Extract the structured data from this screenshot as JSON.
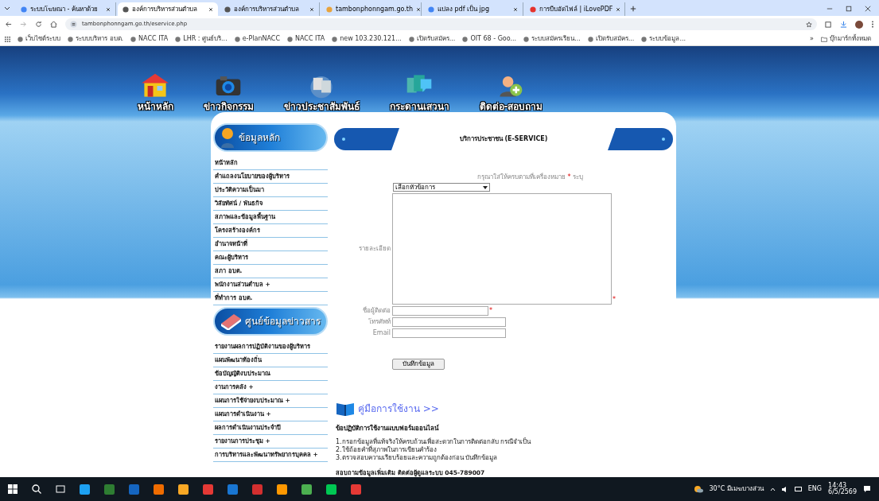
{
  "browser": {
    "tabs": [
      {
        "title": "ระบบโฆษณา - ค้นหาด้วย",
        "selected": false
      },
      {
        "title": "องค์การบริหารส่วนตำบล",
        "selected": true
      },
      {
        "title": "องค์การบริหารส่วนตำบล",
        "selected": false
      },
      {
        "title": "tambonphonngam.go.th",
        "selected": false
      },
      {
        "title": "แปลง pdf เป็น jpg",
        "selected": false
      },
      {
        "title": "การบีบอัดไฟล์ | iLovePDF",
        "selected": false
      }
    ],
    "address": "tambonphonngam.go.th/eservice.php",
    "bookmarks": [
      "เว็บไซต์ระบบ",
      "ระบบบริหาร อบต.",
      "NACC ITA",
      "LHR : ศูนย์บริ...",
      "e-PlanNACC",
      "NACC ITA",
      "new 103.230.121...",
      "เปิดรับสมัคร...",
      "OIT 68 - Goo...",
      "ระบบสมัครเรียน...",
      "เปิดรับสมัคร...",
      "ระบบข้อมูล..."
    ],
    "bookmarks_more": "»",
    "all_bookmarks": "บุ๊กมาร์กทั้งหมด"
  },
  "nav": [
    "หน้าหลัก",
    "ข่าวกิจกรรม",
    "ข่าวประชาสัมพันธ์",
    "กระดานเสวนา",
    "ติดต่อ-สอบถาม"
  ],
  "sidebar": [
    {
      "heading": "ข้อมูลหลัก",
      "items": [
        "หน้าหลัก",
        "คำแถลงนโยบายของผู้บริหาร",
        "ประวัติความเป็นมา",
        "วิสัยทัศน์ / พันธกิจ",
        "สภาพและข้อมูลพื้นฐาน",
        "โครงสร้างองค์กร",
        "อำนาจหน้าที่",
        "คณะผู้บริหาร",
        "สภา อบต.",
        "พนักงานส่วนตำบล +",
        "ที่ทำการ อบต."
      ]
    },
    {
      "heading": "ศูนย์ข้อมูลข่าวสาร",
      "items": [
        "รายงานผลการปฏิบัติงานของผู้บริหาร",
        "แผนพัฒนาท้องถิ่น",
        "ข้อบัญญัติงบประมาณ",
        "งานการคลัง +",
        "แผนการใช้จ่ายงบประมาณ +",
        "แผนการดำเนินงาน +",
        "ผลการดำเนินงานประจำปี",
        "รายงานการประชุม +",
        "การบริหารและพัฒนาทรัพยากรบุคคล +"
      ]
    }
  ],
  "form": {
    "title": "บริการประชาชน (E-SERVICE)",
    "hint": "กรุณาใส่ให้ครบตามที่เครื่องหมาย",
    "required_mark": "*",
    "hint_end": "ระบุ",
    "topic": "เลือกหัวข้อการ",
    "fields": [
      {
        "label": "รายละเอียด",
        "kind": "textarea",
        "required": true
      },
      {
        "label": "ชื่อผู้ติดต่อ",
        "kind": "text",
        "required": true
      },
      {
        "label": "โทรศัพท์",
        "kind": "text",
        "required": false
      },
      {
        "label": "Email",
        "kind": "text",
        "required": false
      }
    ],
    "submit": "บันทึกข้อมูล"
  },
  "manual_link": "คู่มือการใช้งาน >>",
  "rules": {
    "heading": "ข้อปฏิบัติการใช้งานแบบฟอร์มออนไลน์",
    "lines": [
      "1.กรอกข้อมูลที่แท้จริงให้ครบถ้วนเพื่อสะดวกในการติดต่อกลับ กรณีจำเป็น",
      "2.ใช้ถ้อยคำที่สุภาพในการเขียนคำร้อง",
      "3.ตรวจสอบความเรียบร้อยและความถูกต้องก่อน บันทึกข้อมูล"
    ]
  },
  "contact": "สอบถามข้อมูลเพิ่มเติม ติดต่อผู้ดูแลระบบ 045-789007",
  "taskbar": {
    "weather": "30°C มีเมฆบางส่วน",
    "language": "ENG",
    "time": "14:43",
    "date": "6/5/2569"
  }
}
